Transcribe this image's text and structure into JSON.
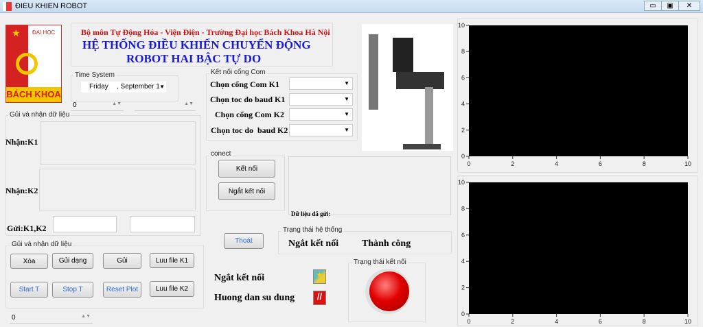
{
  "window": {
    "title": "ĐIEU KHIEN ROBOT",
    "minimize": "▭",
    "maximize": "▣",
    "close": "✕"
  },
  "header": {
    "subtitle": "Bộ môn Tự Động Hóa - Viện Điện - Trường Đại học Bách Khoa Hà Nội",
    "title_line1": "HỆ THỐNG ĐIỀU KHIỂN CHUYỂN ĐỘNG",
    "title_line2": "ROBOT HAI BẬC TỰ DO"
  },
  "logo": {
    "top": "ĐẠI HỌC",
    "bottom": "BÁCH KHOA"
  },
  "time_system": {
    "label": "Time System",
    "day": "Friday",
    "date": ", September 1"
  },
  "spinners": {
    "s1": "0",
    "s2": "",
    "s3": "0"
  },
  "data_group": {
    "label": "Gủi và nhận dữ liệu",
    "recv_k1": "Nhận:K1",
    "recv_k2": "Nhận:K2",
    "send": "Gửi:K1,K2",
    "send_k1_value": "",
    "send_k2_value": ""
  },
  "buttons_group": {
    "label": "Gủi và nhận dữ liệu",
    "xoa": "Xóa",
    "gui_dang": "Gủi dạng",
    "gui": "Gủi",
    "luu_k1": "Luu file K1",
    "start": "Start T",
    "stop": "Stop T",
    "reset": "Reset Plot",
    "luu_k2": "Luu file K2"
  },
  "com_group": {
    "label": "Kết nối cổng Com",
    "com_k1": "Chọn cổng Com K1",
    "baud_k1": "Chọn toc do baud K1",
    "com_k2": "Chọn cổng Com K2",
    "baud_k2": "Chọn toc do  baud K2"
  },
  "connect_group": {
    "label": "conect",
    "connect": "Kết nối",
    "disconnect": "Ngắt kết nối"
  },
  "sent_data": {
    "label": "Dữ liệu đã gửi:"
  },
  "exit": "Thoát",
  "system_status": {
    "label": "Trạng thái hệ thống",
    "state": "Ngắt kết nối",
    "result": "Thành công"
  },
  "links": {
    "disconnect": "Ngắt kết nối",
    "guide": "Huong dan su dung"
  },
  "connection_status": {
    "label": "Trạng thái kết nối",
    "color": "#e00000"
  },
  "chart_data": [
    {
      "type": "line",
      "title": "",
      "xlabel": "",
      "ylabel": "",
      "xlim": [
        0,
        10
      ],
      "ylim": [
        0,
        10
      ],
      "xticks": [
        "0",
        "2",
        "4",
        "6",
        "8",
        "10"
      ],
      "yticks": [
        "0",
        "2",
        "4",
        "6",
        "8",
        "10"
      ],
      "series": []
    },
    {
      "type": "line",
      "title": "",
      "xlabel": "",
      "ylabel": "",
      "xlim": [
        0,
        10
      ],
      "ylim": [
        0,
        10
      ],
      "xticks": [
        "0",
        "2",
        "4",
        "6",
        "8",
        "10"
      ],
      "yticks": [
        "0",
        "2",
        "4",
        "6",
        "8",
        "10"
      ],
      "series": []
    }
  ]
}
